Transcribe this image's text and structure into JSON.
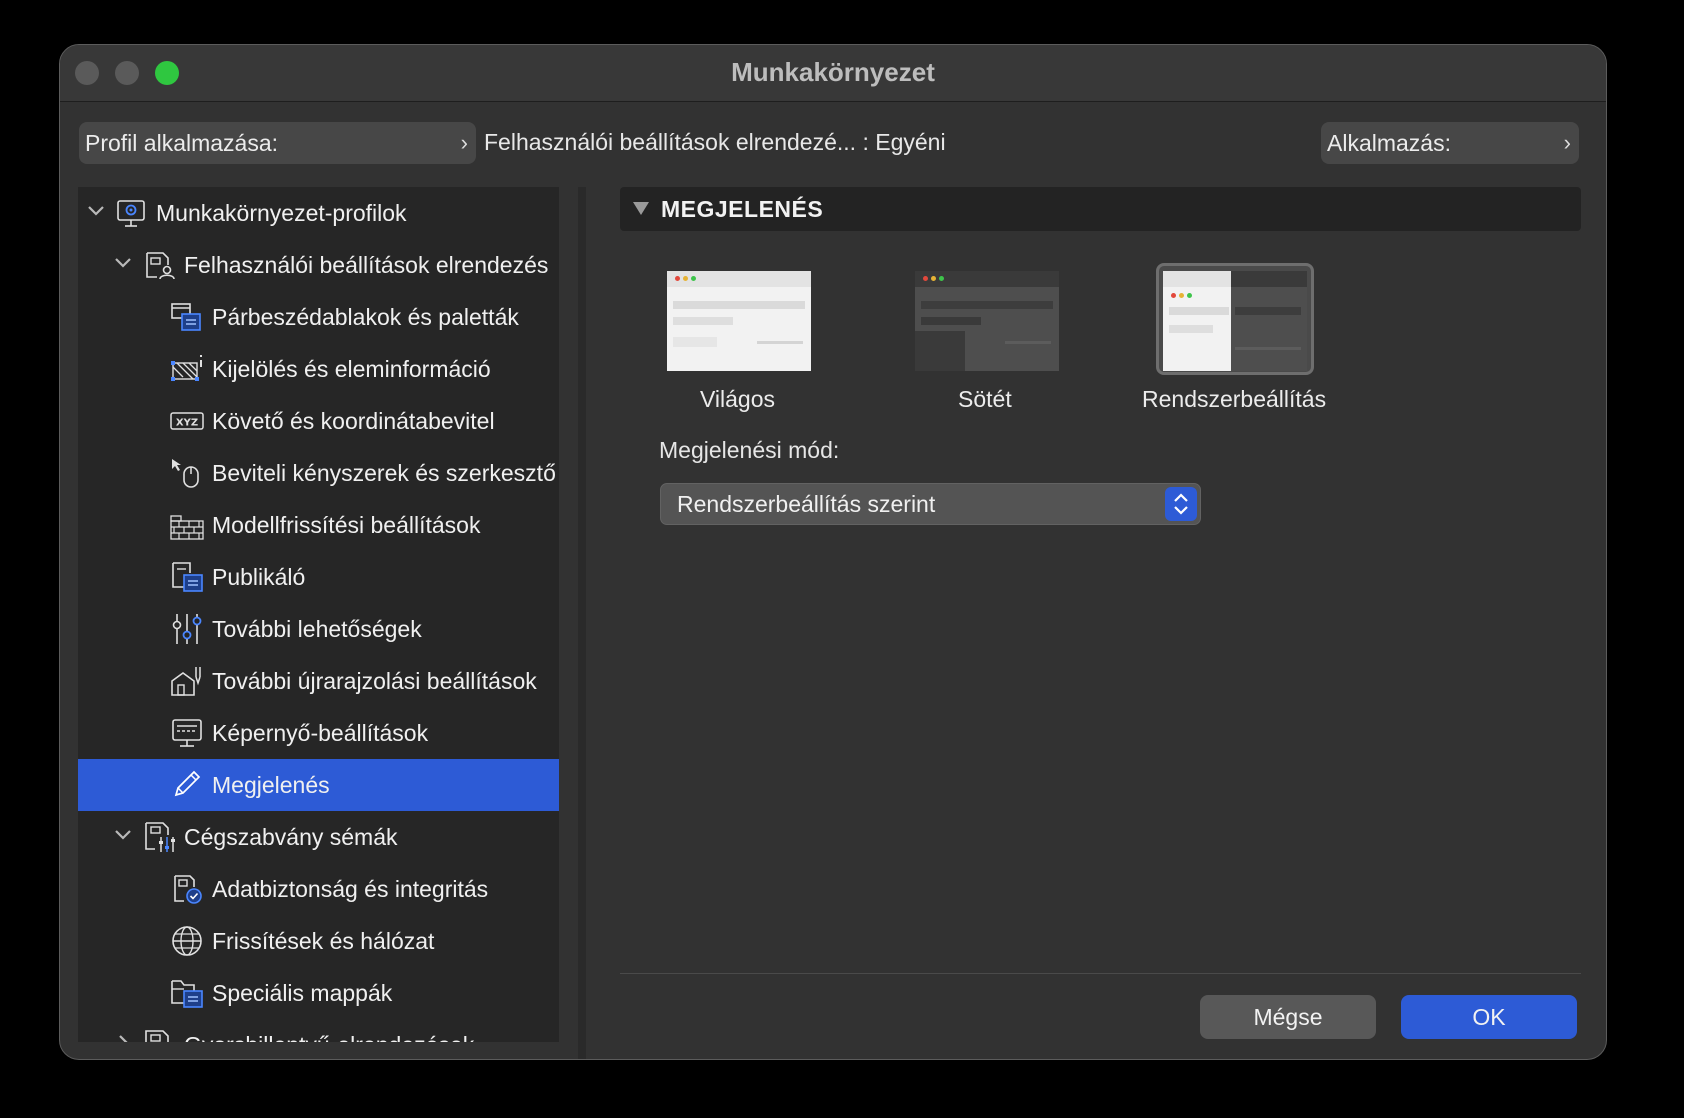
{
  "window": {
    "title": "Munkakörnyezet"
  },
  "toolbar": {
    "profile_label": "Profil alkalmazása:",
    "profile_path": "Felhasználói beállítások elrendezé... : Egyéni",
    "apply_label": "Alkalmazás:"
  },
  "sidebar": {
    "items": [
      {
        "label": "Munkakörnyezet-profilok"
      },
      {
        "label": "Felhasználói beállítások elrendezés"
      },
      {
        "label": "Párbeszédablakok és paletták"
      },
      {
        "label": "Kijelölés és eleminformáció"
      },
      {
        "label": "Követő és koordinátabevitel"
      },
      {
        "label": "Beviteli kényszerek és szerkesztő"
      },
      {
        "label": "Modellfrissítési beállítások"
      },
      {
        "label": "Publikáló"
      },
      {
        "label": "További lehetőségek"
      },
      {
        "label": "További újrarajzolási beállítások"
      },
      {
        "label": "Képernyő-beállítások"
      },
      {
        "label": "Megjelenés"
      },
      {
        "label": "Cégszabvány sémák"
      },
      {
        "label": "Adatbiztonság és integritás"
      },
      {
        "label": "Frissítések és hálózat"
      },
      {
        "label": "Speciális mappák"
      },
      {
        "label": "Gyorsbillentyű-elrendezések"
      }
    ],
    "selected": "Megjelenés"
  },
  "main": {
    "section_title": "MEGJELENÉS",
    "themes": [
      {
        "label": "Világos"
      },
      {
        "label": "Sötét"
      },
      {
        "label": "Rendszerbeállítás"
      }
    ],
    "selected_theme": "Rendszerbeállítás",
    "mode_label": "Megjelenési mód:",
    "mode_value": "Rendszerbeállítás szerint"
  },
  "buttons": {
    "cancel": "Mégse",
    "ok": "OK"
  },
  "colors": {
    "accent": "#2d5bd6",
    "close_green": "#2fc740"
  }
}
